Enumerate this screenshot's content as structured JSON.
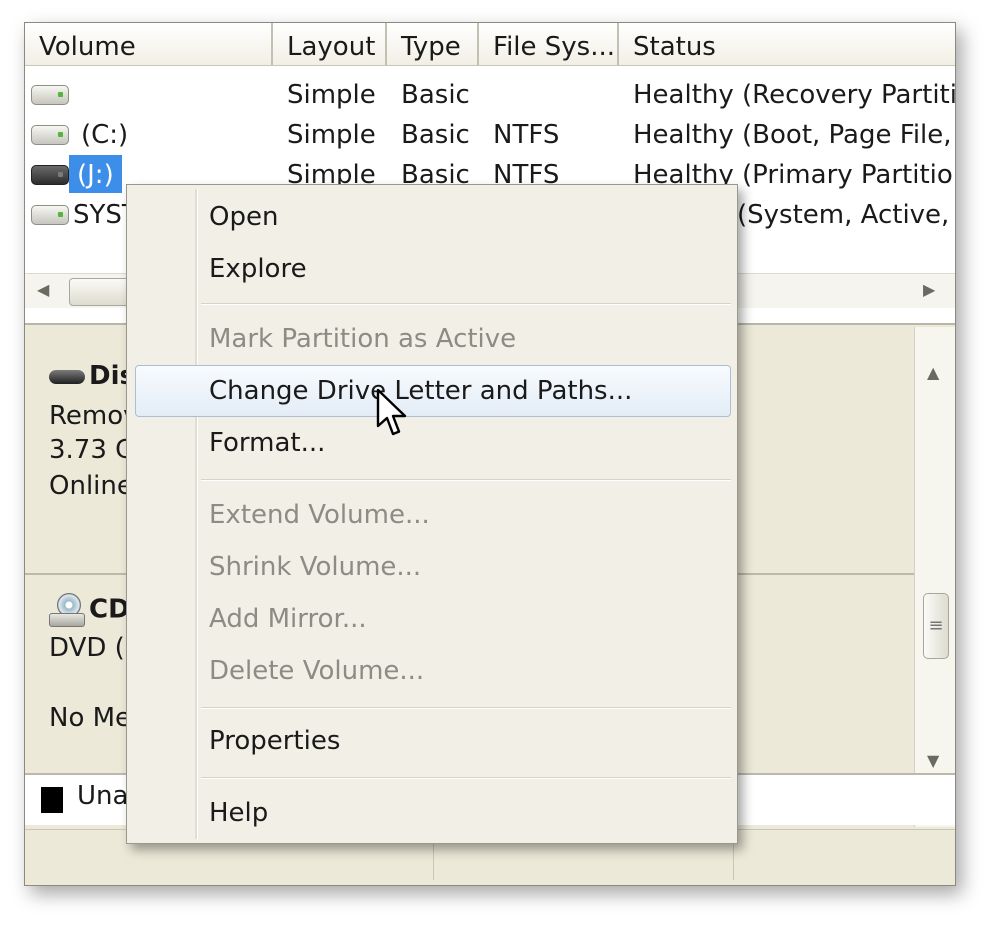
{
  "columns": [
    "Volume",
    "Layout",
    "Type",
    "File Sys...",
    "Status"
  ],
  "volumes": [
    {
      "name": "",
      "layout": "Simple",
      "type": "Basic",
      "fs": "",
      "status": "Healthy (Recovery Partitic"
    },
    {
      "name": "(C:)",
      "layout": "Simple",
      "type": "Basic",
      "fs": "NTFS",
      "status": "Healthy (Boot, Page File, C"
    },
    {
      "name": "(J:)",
      "layout": "Simple",
      "type": "Basic",
      "fs": "NTFS",
      "status": "Healthy (Primary Partition"
    },
    {
      "name": "SYST",
      "layout": "",
      "type": "",
      "fs": "",
      "status": "(System, Active, F"
    }
  ],
  "disks": [
    {
      "title": "Dis",
      "line1": "Remov",
      "line2": "3.73 G",
      "line3": "Online"
    },
    {
      "title": "CD",
      "line1": "DVD (D",
      "line2": "",
      "line3": "No Me"
    }
  ],
  "legend": {
    "unallocated": "Una"
  },
  "menu": {
    "open": "Open",
    "explore": "Explore",
    "mark_active": "Mark Partition as Active",
    "change_letter": "Change Drive Letter and Paths...",
    "format": "Format...",
    "extend": "Extend Volume...",
    "shrink": "Shrink Volume...",
    "add_mirror": "Add Mirror...",
    "delete": "Delete Volume...",
    "properties": "Properties",
    "help": "Help"
  },
  "icons": {
    "drive": "drive-icon",
    "hard_disk": "hard-disk-icon",
    "cd_rom": "cd-rom-icon",
    "cursor": "mouse-pointer-icon"
  },
  "colors": {
    "selection": "#3d8ee8",
    "menu_highlight": "#e3ecf6",
    "unallocated": "#000000"
  }
}
